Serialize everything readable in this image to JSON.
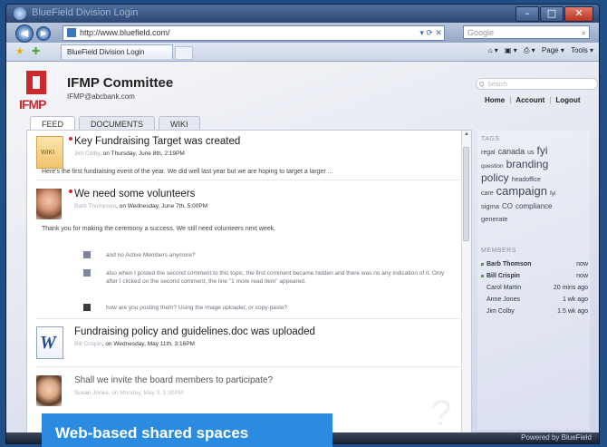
{
  "window": {
    "title": "BlueField Division Login"
  },
  "nav": {
    "url": "http://www.bluefield.com/",
    "search_placeholder": "Google",
    "back_glyph": "◀",
    "fwd_glyph": "▶",
    "search_glyph": "⌕"
  },
  "tabs": {
    "active_label": "BlueField Division Login"
  },
  "command_bar": {
    "page": "Page ▾",
    "tools": "Tools ▾"
  },
  "committee": {
    "title": "IFMP Committee",
    "email": "IFMP@abcbank.com",
    "logo_text": "IFMP"
  },
  "page_tabs": [
    {
      "label": "FEED"
    },
    {
      "label": "DOCUMENTS"
    },
    {
      "label": "WIKI"
    }
  ],
  "feed": [
    {
      "title": "Key Fundraising Target was created",
      "author": "Jim Colby",
      "meta": ", on Thursday, June 8th, 2:19PM",
      "body": "Here's the first fundraising event of the year. We did well last year but we are hoping to target a larger ...",
      "thumb_label": "WIKI"
    },
    {
      "title": "We need some volunteers",
      "author": "Barb Thompson",
      "meta": ", on Wednesday, June 7th, 5:00PM",
      "body": "Thank you for making the ceremony a success. We still need volunteers next week."
    },
    {
      "title": "Fundraising policy and guidelines.doc was uploaded",
      "author": "Bill Crispin",
      "meta": ", on Wednesday, May 11th, 3:16PM",
      "thumb_label": "W"
    },
    {
      "title": "Shall we invite the board members to participate?",
      "author": "Susan Jones",
      "meta": ", on Monday, May 9, 1:30PM"
    }
  ],
  "comments": [
    {
      "text": "and no Active Members anymore?"
    },
    {
      "text": "also when I posted the second comment to this topic, the first comment became hidden and there was no any indication of it. Only after I clicked on the second comment, the line \"1 more read item\" appeared."
    },
    {
      "text": "how are you posting them? Using the image uploader, or copy-paste?"
    }
  ],
  "header_links": {
    "search_placeholder": "Search",
    "home": "Home",
    "account": "Account",
    "logout": "Logout",
    "sep": "|"
  },
  "tags": {
    "heading": "TAGS",
    "items": [
      "regal",
      "canada",
      "us",
      "fyi",
      "question",
      "branding",
      "policy",
      "headoffice",
      "care",
      "campaign",
      "fyi",
      "sigma",
      "CO",
      "compliance",
      "generate"
    ]
  },
  "members": {
    "heading": "MEMBERS",
    "items": [
      {
        "name": "Barb Thomson",
        "time": "now",
        "online": true
      },
      {
        "name": "Bill Crispin",
        "time": "now",
        "online": true
      },
      {
        "name": "Carol Martin",
        "time": "20 mins ago",
        "online": false
      },
      {
        "name": "Anne Jones",
        "time": "1 wk ago",
        "online": false
      },
      {
        "name": "Jim Colby",
        "time": "1.5 wk ago",
        "online": false
      }
    ]
  },
  "status": {
    "powered": "Powered by BlueField"
  },
  "caption": "Web-based shared spaces",
  "colors": {
    "accent": "#2b8be0",
    "brand_red": "#c9292c"
  }
}
